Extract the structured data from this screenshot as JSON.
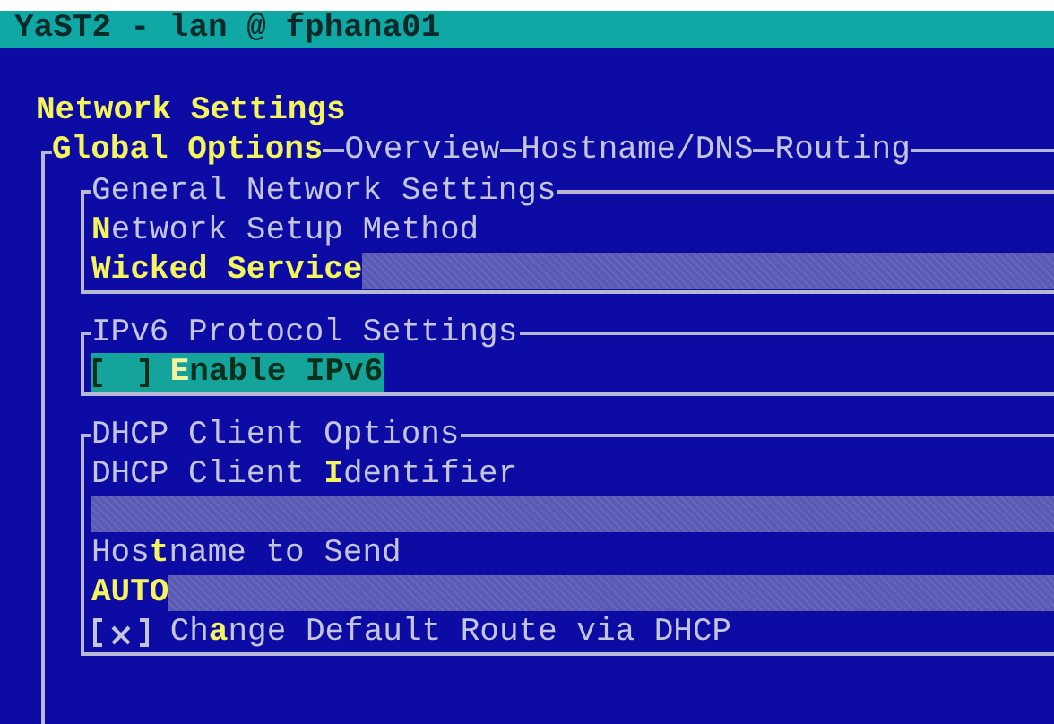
{
  "window": {
    "title": "YaST2 - lan @ fphana01"
  },
  "heading": "Network Settings",
  "tabs": [
    {
      "label": "Global Options",
      "selected": true
    },
    {
      "label": "Overview",
      "selected": false
    },
    {
      "label": "Hostname/DNS",
      "selected": false
    },
    {
      "label": "Routing",
      "selected": false
    }
  ],
  "sections": [
    {
      "title": "General Network Settings",
      "items": [
        {
          "kind": "field",
          "label": "**N**etwork Setup Method",
          "value": "Wicked Service"
        }
      ]
    },
    {
      "title": "IPv6 Protocol Settings",
      "items": [
        {
          "kind": "checkbox",
          "label": "**E**nable IPv6",
          "checked": false,
          "focused": true
        }
      ]
    },
    {
      "title": "DHCP Client Options",
      "items": [
        {
          "kind": "field",
          "label": "DHCP Client **I**dentifier"
        },
        {
          "kind": "field",
          "label": "Hos**t**name to Send",
          "value": "AUTO"
        },
        {
          "kind": "checkbox",
          "label": "Ch**a**nge Default Route via DHCP",
          "checked": true,
          "focused": false
        }
      ]
    }
  ]
}
